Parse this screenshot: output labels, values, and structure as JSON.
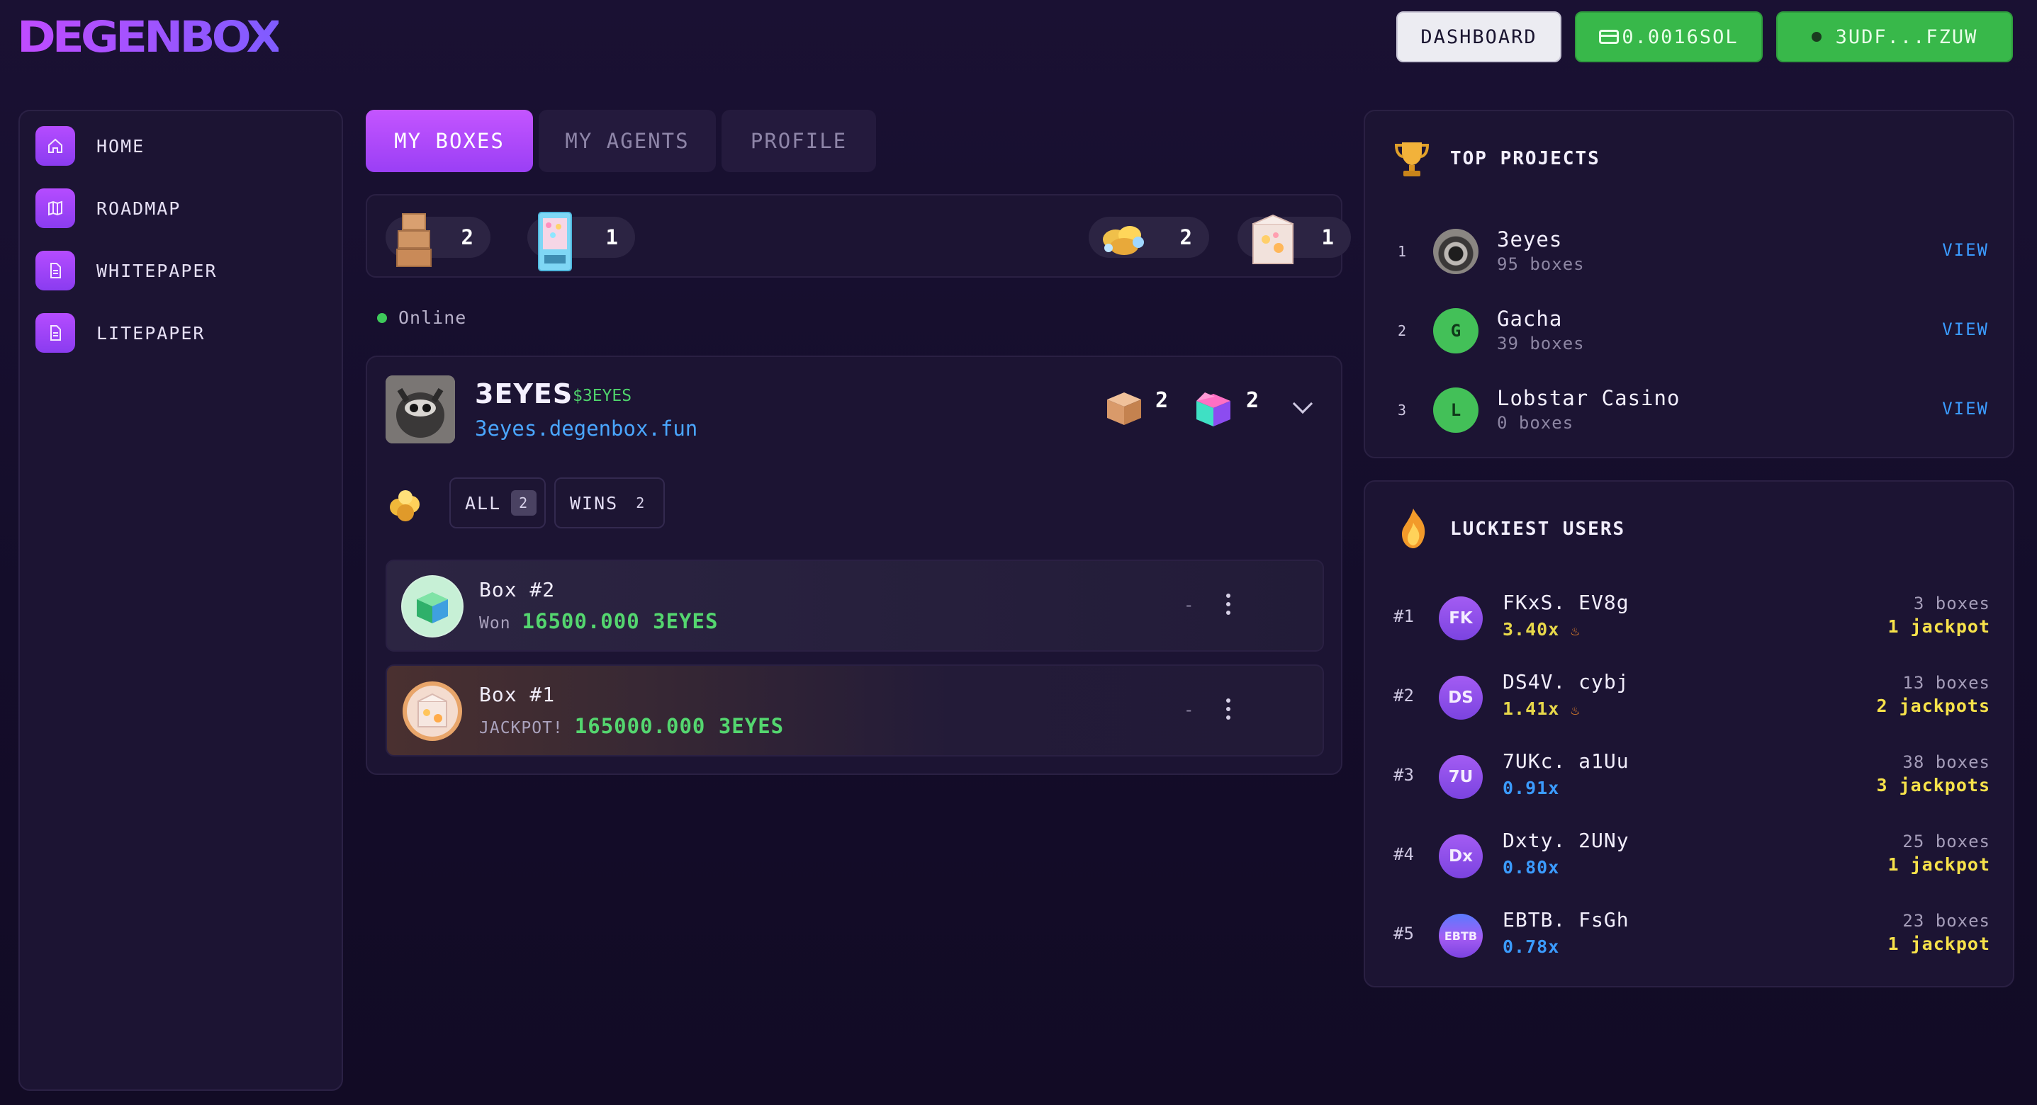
{
  "header": {
    "logo": "DEGENBOX",
    "dashboard_label": "DASHBOARD",
    "balance_label": "0.0016SOL",
    "wallet_label": "3UDF...FZUW"
  },
  "sidebar": {
    "items": [
      {
        "label": "HOME",
        "icon": "home-icon"
      },
      {
        "label": "ROADMAP",
        "icon": "map-icon"
      },
      {
        "label": "WHITEPAPER",
        "icon": "document-icon"
      },
      {
        "label": "LITEPAPER",
        "icon": "document-icon"
      }
    ]
  },
  "tabs": [
    {
      "label": "MY BOXES",
      "active": true
    },
    {
      "label": "MY AGENTS",
      "active": false
    },
    {
      "label": "PROFILE",
      "active": false
    }
  ],
  "counters": [
    {
      "icon": "box-stack-icon",
      "count": "2"
    },
    {
      "icon": "vending-machine-icon",
      "count": "1"
    },
    {
      "icon": "gold-coins-icon",
      "count": "2"
    },
    {
      "icon": "crystal-box-icon",
      "count": "1"
    }
  ],
  "status": {
    "text": "Online",
    "color": "#3ec95a"
  },
  "project": {
    "name": "3EYES",
    "ticker": "$3EYES",
    "link": "3eyes.degenbox.fun",
    "box_count_closed": "2",
    "box_count_open": "2",
    "filters": [
      {
        "label": "ALL",
        "count": "2"
      },
      {
        "label": "WINS",
        "count": "2"
      }
    ],
    "boxes": [
      {
        "title": "Box #2",
        "prefix": "Won",
        "value": "16500.000 3EYES",
        "dash": "-"
      },
      {
        "title": "Box #1",
        "prefix": "JACKPOT!",
        "value": "165000.000 3EYES",
        "dash": "-"
      }
    ]
  },
  "top_projects": {
    "title": "TOP PROJECTS",
    "view_label": "VIEW",
    "items": [
      {
        "rank": "1",
        "name": "3eyes",
        "sub": "95 boxes",
        "initial": ""
      },
      {
        "rank": "2",
        "name": "Gacha",
        "sub": "39 boxes",
        "initial": "G"
      },
      {
        "rank": "3",
        "name": "Lobstar Casino",
        "sub": "0 boxes",
        "initial": "L"
      }
    ]
  },
  "luckiest": {
    "title": "LUCKIEST USERS",
    "items": [
      {
        "rank": "#1",
        "initials": "FK",
        "name": "FKxS. EV8g",
        "mult": "3.40x",
        "hot": true,
        "boxes": "3 boxes",
        "jackpots": "1 jackpot"
      },
      {
        "rank": "#2",
        "initials": "DS",
        "name": "DS4V. cybj",
        "mult": "1.41x",
        "hot": true,
        "boxes": "13 boxes",
        "jackpots": "2 jackpots"
      },
      {
        "rank": "#3",
        "initials": "7U",
        "name": "7UKc. a1Uu",
        "mult": "0.91x",
        "hot": false,
        "boxes": "38 boxes",
        "jackpots": "3 jackpots"
      },
      {
        "rank": "#4",
        "initials": "Dx",
        "name": "Dxty. 2UNy",
        "mult": "0.80x",
        "hot": false,
        "boxes": "25 boxes",
        "jackpots": "1 jackpot"
      },
      {
        "rank": "#5",
        "initials": "EBTB",
        "name": "EBTB. FsGh",
        "mult": "0.78x",
        "hot": false,
        "boxes": "23 boxes",
        "jackpots": "1 jackpot"
      }
    ]
  },
  "colors": {
    "accent": "#b04dff",
    "green": "#38b84a",
    "link": "#3b9bff",
    "hot": "#e8d84a",
    "cold": "#3b9bff",
    "jackpot": "#f7e24a"
  }
}
